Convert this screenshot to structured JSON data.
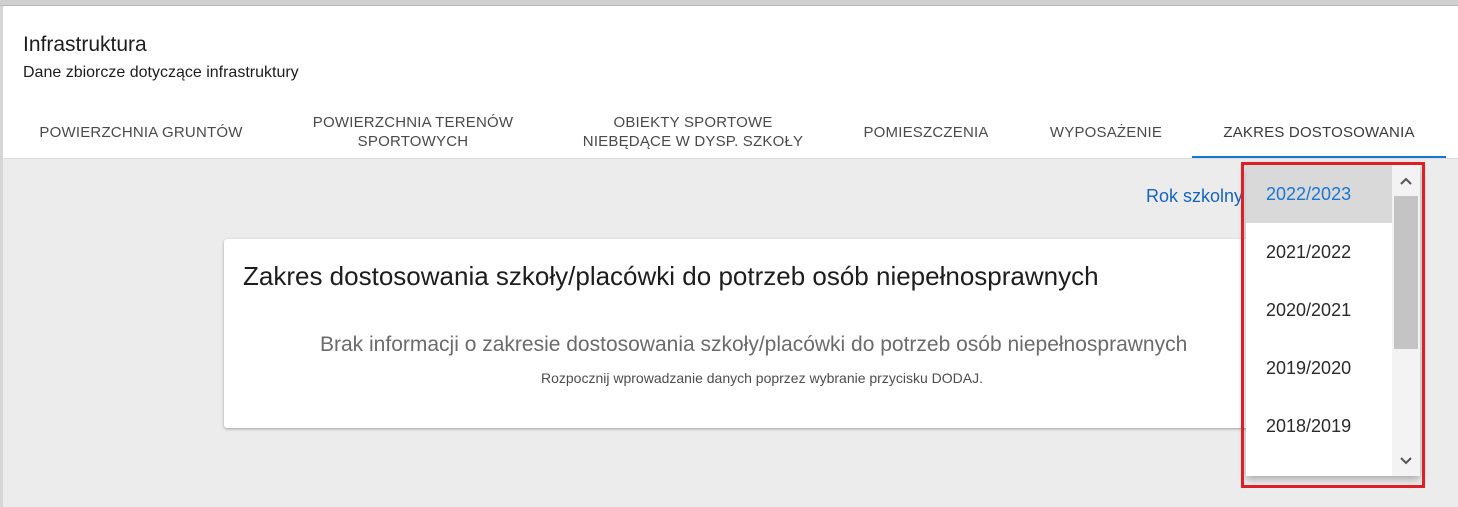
{
  "header": {
    "title": "Infrastruktura",
    "subtitle": "Dane zbiorcze dotyczące infrastruktury"
  },
  "tabs": [
    {
      "label": "POWIERZCHNIA GRUNTÓW",
      "active": false
    },
    {
      "label": "POWIERZCHNIA TERENÓW SPORTOWYCH",
      "active": false
    },
    {
      "label": "OBIEKTY SPORTOWE NIEBĘDĄCE W DYSP. SZKOŁY",
      "active": false
    },
    {
      "label": "POMIESZCZENIA",
      "active": false
    },
    {
      "label": "WYPOSAŻENIE",
      "active": false
    },
    {
      "label": "ZAKRES DOSTOSOWANIA",
      "active": true
    }
  ],
  "school_year": {
    "label": "Rok szkolny",
    "options": [
      "2022/2023",
      "2021/2022",
      "2020/2021",
      "2019/2020",
      "2018/2019"
    ],
    "selected": "2022/2023"
  },
  "card": {
    "title": "Zakres dostosowania szkoły/placówki do potrzeb osób niepełnosprawnych",
    "empty_title": "Brak informacji o zakresie dostosowania szkoły/placówki do potrzeb osób niepełnosprawnych",
    "empty_hint": "Rozpocznij wprowadzanie danych poprzez wybranie przycisku DODAJ."
  },
  "colors": {
    "accent": "#1976d2",
    "highlight_border": "#e01e26",
    "background": "#ececec"
  },
  "icons": {
    "scroll_up": "chevron-up-icon",
    "scroll_down": "chevron-down-icon"
  }
}
